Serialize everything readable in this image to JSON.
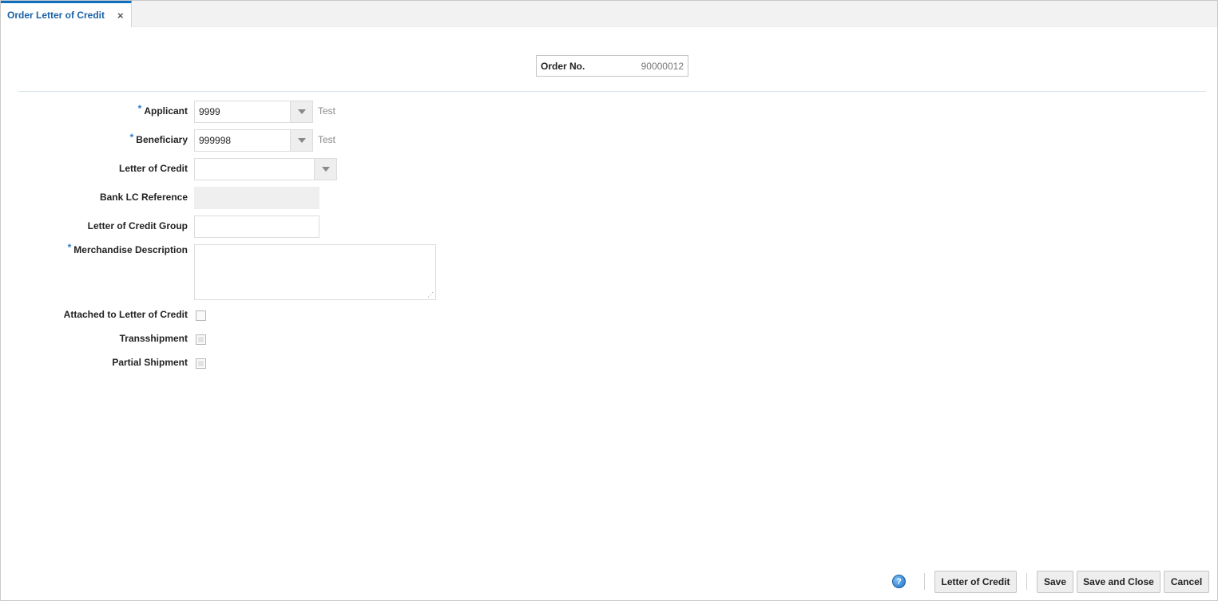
{
  "tab": {
    "title": "Order Letter of Credit",
    "close_icon": "×"
  },
  "order": {
    "label": "Order No.",
    "value": "90000012"
  },
  "form": {
    "applicant": {
      "label": "Applicant",
      "required": "*",
      "value": "9999",
      "description": "Test"
    },
    "beneficiary": {
      "label": "Beneficiary",
      "required": "*",
      "value": "999998",
      "description": "Test"
    },
    "letter_of_credit": {
      "label": "Letter of Credit",
      "value": ""
    },
    "bank_lc_reference": {
      "label": "Bank LC Reference",
      "value": ""
    },
    "lc_group": {
      "label": "Letter of Credit Group",
      "value": ""
    },
    "merchandise_description": {
      "label": "Merchandise Description",
      "required": "*",
      "value": ""
    },
    "attached_to_lc": {
      "label": "Attached to Letter of Credit",
      "checked": false
    },
    "transshipment": {
      "label": "Transshipment",
      "checked": false
    },
    "partial_shipment": {
      "label": "Partial Shipment",
      "checked": false
    }
  },
  "footer": {
    "help_icon": "?",
    "letter_of_credit": "Letter of Credit",
    "save": "Save",
    "save_and_close": "Save and Close",
    "cancel": "Cancel"
  }
}
